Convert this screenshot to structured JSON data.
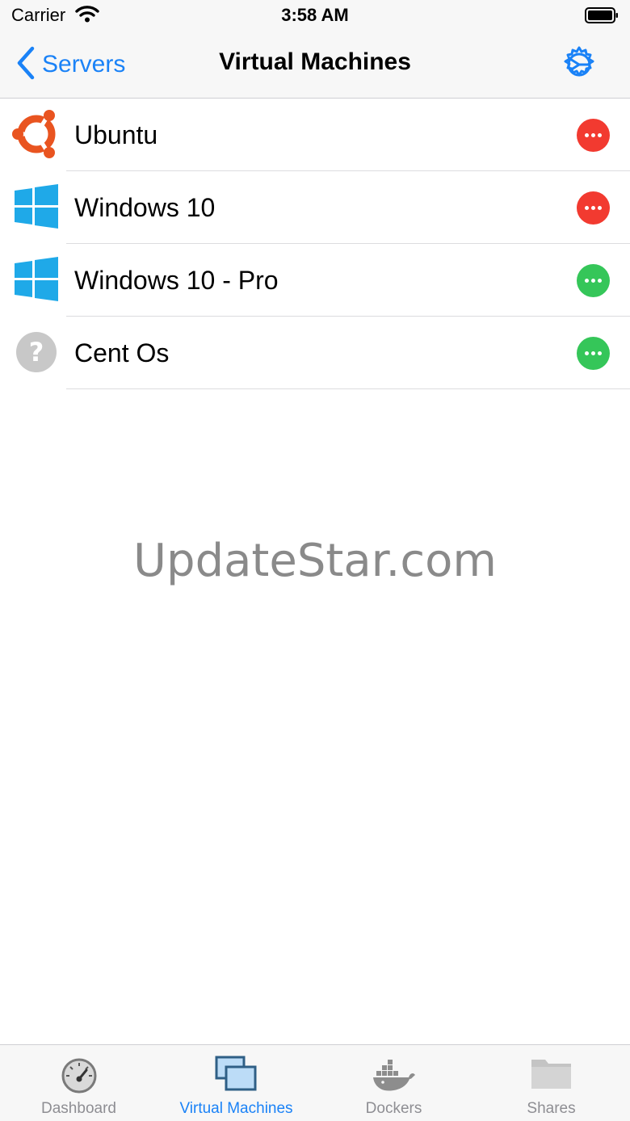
{
  "status_bar": {
    "carrier": "Carrier",
    "time": "3:58 AM"
  },
  "nav": {
    "back_label": "Servers",
    "title": "Virtual Machines",
    "settings_icon": "settings-gear-icon"
  },
  "vms": [
    {
      "name": "Ubuntu",
      "os_icon": "ubuntu-logo-icon",
      "status": "stopped",
      "status_color": "#f23a30"
    },
    {
      "name": "Windows 10",
      "os_icon": "windows-logo-icon",
      "status": "stopped",
      "status_color": "#f23a30"
    },
    {
      "name": "Windows 10 - Pro",
      "os_icon": "windows-logo-icon",
      "status": "running",
      "status_color": "#35c659"
    },
    {
      "name": "Cent Os",
      "os_icon": "unknown-os-icon",
      "status": "running",
      "status_color": "#35c659"
    }
  ],
  "watermark": "UpdateStar.com",
  "tabs": [
    {
      "label": "Dashboard",
      "icon": "speedometer-icon",
      "active": false
    },
    {
      "label": "Virtual Machines",
      "icon": "virtual-machines-icon",
      "active": true
    },
    {
      "label": "Dockers",
      "icon": "docker-whale-icon",
      "active": false
    },
    {
      "label": "Shares",
      "icon": "folder-icon",
      "active": false
    }
  ],
  "colors": {
    "accent": "#1a82f7",
    "stopped": "#f23a30",
    "running": "#35c659",
    "ubuntu": "#e95420",
    "windows": "#1fa9e8"
  }
}
